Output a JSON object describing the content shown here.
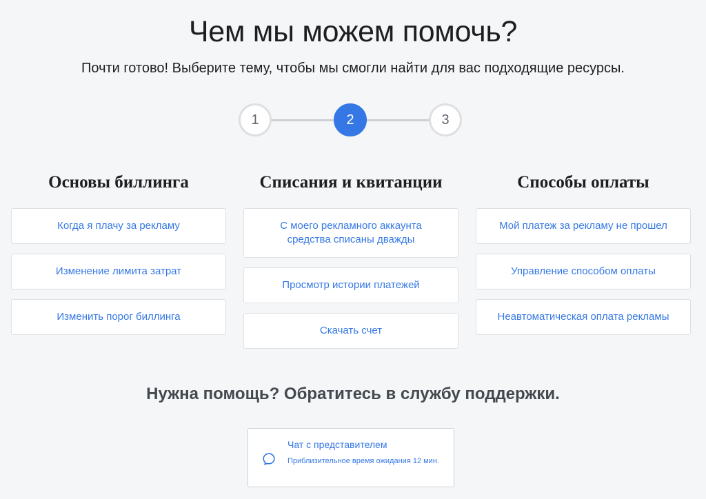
{
  "header": {
    "title": "Чем мы можем помочь?",
    "subtitle": "Почти готово! Выберите тему, чтобы мы смогли найти для вас подходящие ресурсы."
  },
  "stepper": {
    "steps": [
      "1",
      "2",
      "3"
    ],
    "active_step": 2
  },
  "columns": [
    {
      "title": "Основы биллинга",
      "items": [
        "Когда я плачу за рекламу",
        "Изменение лимита затрат",
        "Изменить порог биллинга"
      ]
    },
    {
      "title": "Списания и квитанции",
      "items": [
        "С моего рекламного аккаунта средства списаны дважды",
        "Просмотр истории платежей",
        "Скачать счет"
      ]
    },
    {
      "title": "Способы оплаты",
      "items": [
        "Мой платеж за рекламу не прошел",
        "Управление способом оплаты",
        "Неавтоматическая оплата рекламы"
      ]
    }
  ],
  "support": {
    "title": "Нужна помощь? Обратитесь в службу поддержки.",
    "chat_title": "Чат с представителем",
    "chat_wait": "Приблизительное время ожидания 12 мин.",
    "chat_icon": "chat-bubble-icon"
  },
  "colors": {
    "accent": "#3578e5",
    "background": "#f5f6f7"
  }
}
